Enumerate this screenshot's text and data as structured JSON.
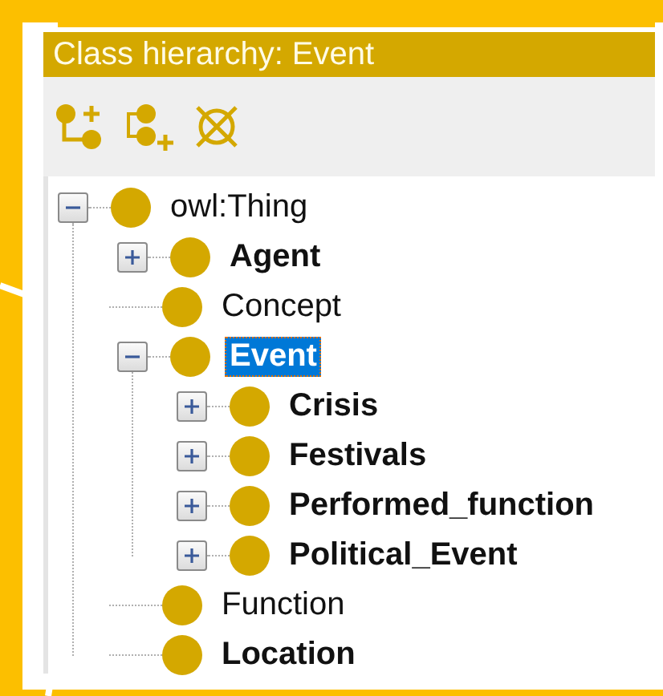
{
  "panel": {
    "title": "Class hierarchy: Event"
  },
  "tree": [
    {
      "label": "owl:Thing",
      "kind": "branch",
      "expanded": true,
      "bold": false,
      "selected": false,
      "children": [
        {
          "label": "Agent",
          "kind": "branch",
          "expanded": false,
          "bold": true,
          "selected": false
        },
        {
          "label": "Concept",
          "kind": "leaf",
          "bold": false,
          "selected": false
        },
        {
          "label": "Event",
          "kind": "branch",
          "expanded": true,
          "bold": true,
          "selected": true,
          "children": [
            {
              "label": "Crisis",
              "kind": "branch",
              "expanded": false,
              "bold": true,
              "selected": false
            },
            {
              "label": "Festivals",
              "kind": "branch",
              "expanded": false,
              "bold": true,
              "selected": false
            },
            {
              "label": "Performed_function",
              "kind": "branch",
              "expanded": false,
              "bold": true,
              "selected": false
            },
            {
              "label": "Political_Event",
              "kind": "branch",
              "expanded": false,
              "bold": true,
              "selected": false
            }
          ]
        },
        {
          "label": "Function",
          "kind": "leaf",
          "bold": false,
          "selected": false
        },
        {
          "label": "Location",
          "kind": "leaf",
          "bold": true,
          "selected": false
        }
      ]
    }
  ]
}
